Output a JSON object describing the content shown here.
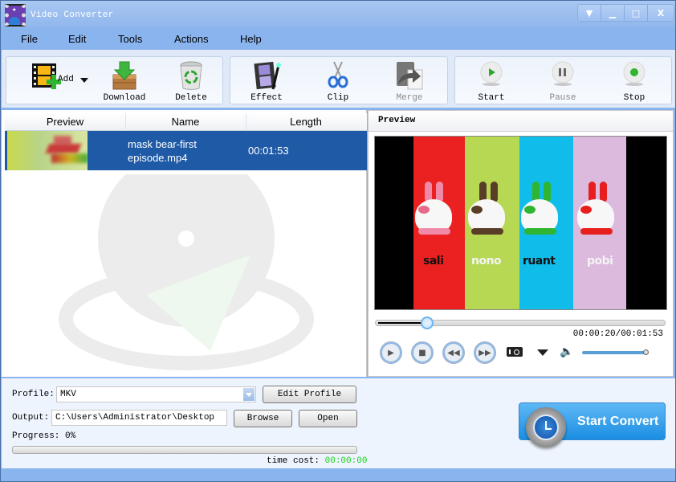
{
  "window": {
    "title": "Video Converter",
    "controls": {
      "menu_icon": "▼",
      "minimize_icon": "▁",
      "maximize_icon": "□",
      "close_icon": "X"
    }
  },
  "menu": [
    "File",
    "Edit",
    "Tools",
    "Actions",
    "Help"
  ],
  "toolbar": {
    "add": {
      "label": "Add",
      "icon": "film-add-icon"
    },
    "download": {
      "label": "Download",
      "icon": "download-box-icon"
    },
    "delete": {
      "label": "Delete",
      "icon": "recycle-bin-icon"
    },
    "effect": {
      "label": "Effect",
      "icon": "film-effect-icon"
    },
    "clip": {
      "label": "Clip",
      "icon": "scissors-icon"
    },
    "merge": {
      "label": "Merge",
      "icon": "merge-icon",
      "disabled": true
    },
    "start": {
      "label": "Start",
      "icon": "play-icon"
    },
    "pause": {
      "label": "Pause",
      "icon": "pause-icon",
      "disabled": true
    },
    "stop": {
      "label": "Stop",
      "icon": "stop-icon"
    }
  },
  "file_list": {
    "columns": [
      "Preview",
      "Name",
      "Length"
    ],
    "rows": [
      {
        "name_line1": "mask bear-first",
        "name_line2": "episode.mp4",
        "length": "00:01:53",
        "selected": true
      }
    ]
  },
  "preview": {
    "title": "Preview",
    "characters": [
      "sali",
      "nono",
      "ruant",
      "pobi"
    ],
    "time_readout": "00:00:20/00:01:53",
    "position_fraction": 0.177,
    "volume_fraction": 1.0
  },
  "bottom": {
    "profile_label": "Profile:",
    "profile_value": "MKV",
    "edit_profile_label": "Edit Profile",
    "output_label": "Output:",
    "output_value": "C:\\Users\\Administrator\\Desktop",
    "browse_label": "Browse",
    "open_label": "Open",
    "progress_label": "Progress: 0%",
    "progress_fraction": 0,
    "time_cost_label": "time cost:",
    "time_cost_value": "00:00:00",
    "start_convert_label": "Start Convert"
  },
  "colors": {
    "selection": "#1f5aa6",
    "time_cost": "#17d017",
    "accent": "#1a8ee2"
  }
}
